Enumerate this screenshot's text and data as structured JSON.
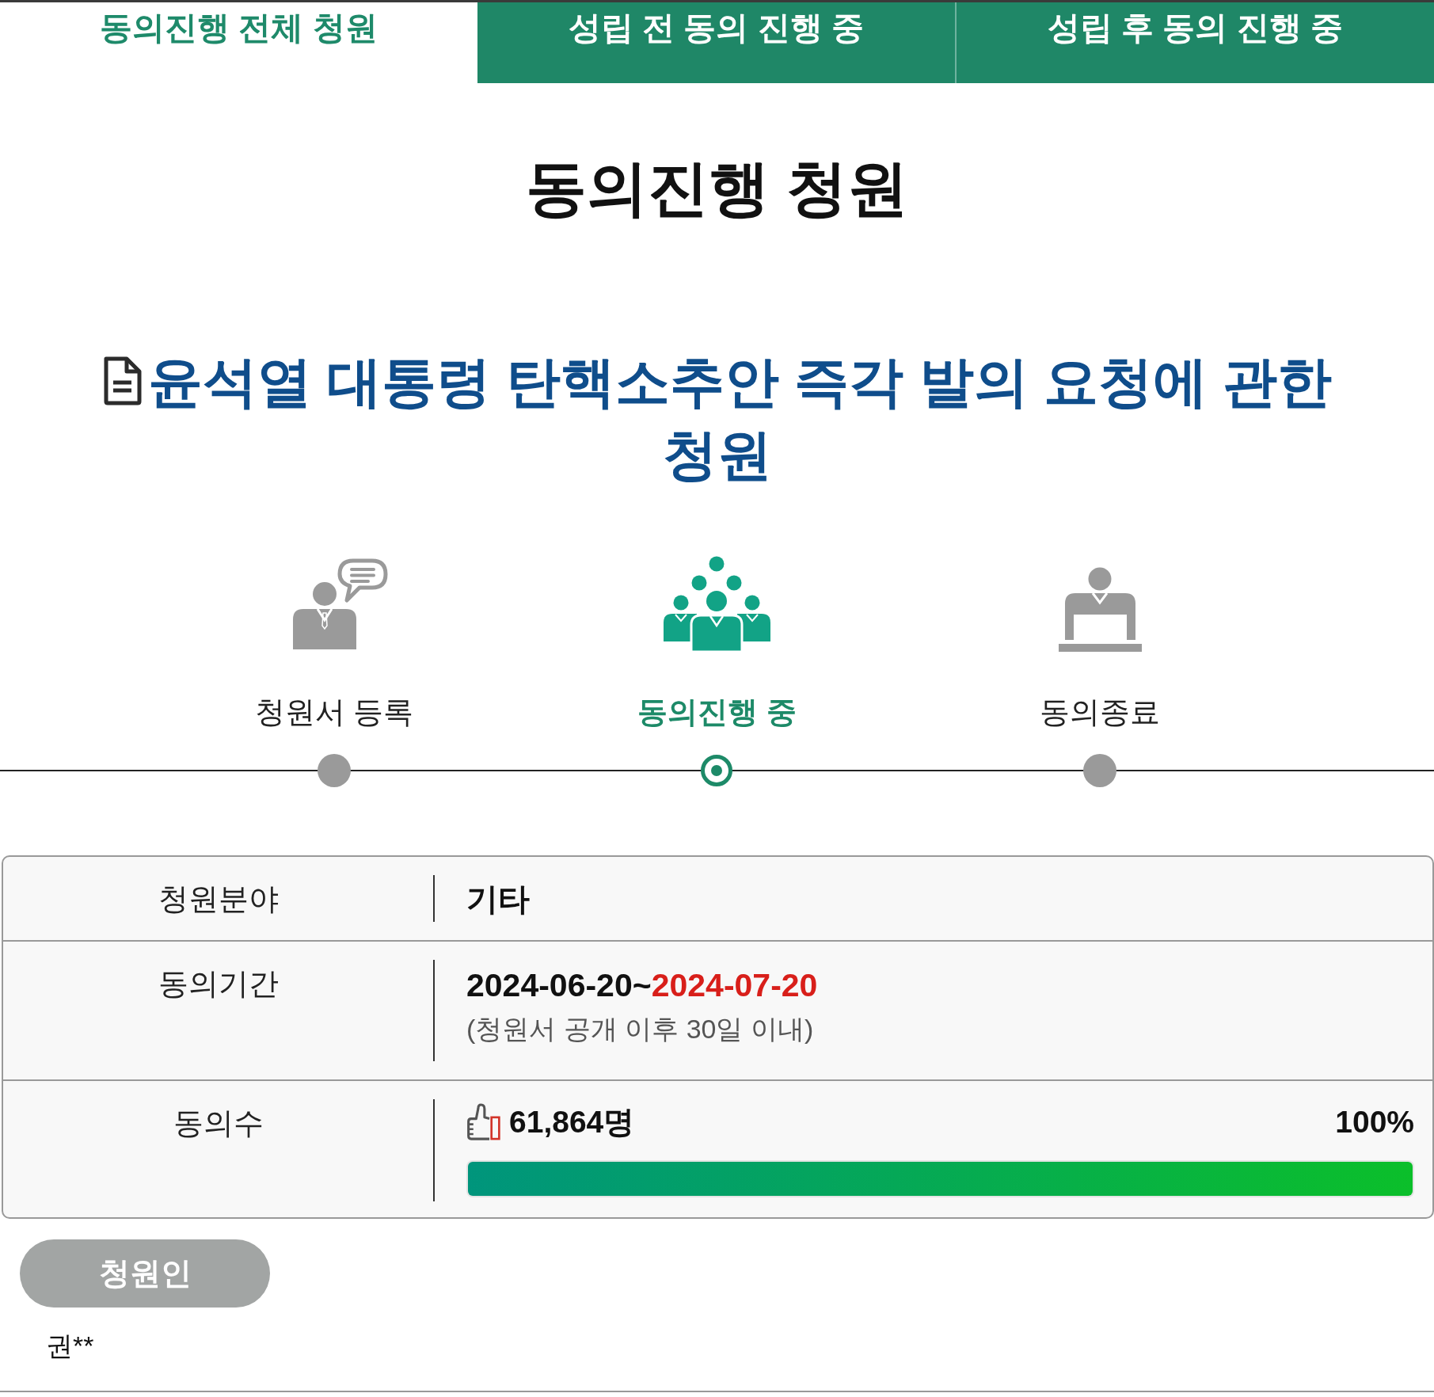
{
  "tabs": [
    {
      "label": "동의진행 전체 청원",
      "selected": true
    },
    {
      "label": "성립 전 동의 진행 중",
      "selected": false
    },
    {
      "label": "성립 후 동의 진행 중",
      "selected": false
    }
  ],
  "page_title": "동의진행 청원",
  "petition_title": "윤석열 대통령 탄핵소추안 즉각 발의 요청에 관한 청원",
  "steps": [
    {
      "kind": "register",
      "label": "청원서 등록",
      "selected": false
    },
    {
      "kind": "consent",
      "label": "동의진행 중",
      "selected": true
    },
    {
      "kind": "closed",
      "label": "동의종료",
      "selected": false
    }
  ],
  "details": [
    {
      "kind": "text",
      "label": "청원분야",
      "value": "기타"
    },
    {
      "kind": "period",
      "label": "동의기간",
      "start": "2024-06-20",
      "separator": "~",
      "end": "2024-07-20",
      "note": "(청원서 공개 이후 30일 이내)"
    },
    {
      "kind": "count",
      "label": "동의수",
      "count": "61,864명",
      "percent": "100%",
      "level": 1
    }
  ],
  "petitioner": {
    "heading": "청원인",
    "name": "권**"
  }
}
